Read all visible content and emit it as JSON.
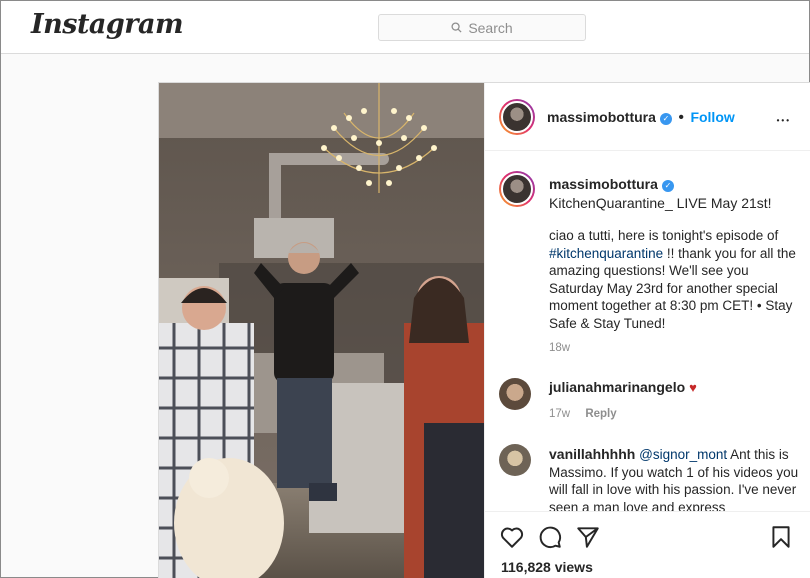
{
  "app": {
    "logo": "Instagram"
  },
  "search": {
    "placeholder": "Search"
  },
  "post": {
    "username": "massimobottura",
    "follow_separator": "•",
    "follow_label": "Follow",
    "more_label": "•••",
    "caption": {
      "username": "massimobottura",
      "title_line": "KitchenQuarantine_ LIVE May 21st!",
      "body_before_tag": "ciao a tutti, here is tonight's episode of",
      "hashtag": "#kitchenquarantine",
      "body_after_tag": "!! thank you for all the amazing questions! We'll see you Saturday May 23rd for another special moment together at 8:30 pm CET! • Stay Safe & Stay Tuned!",
      "time": "18w"
    },
    "comments": [
      {
        "username": "julianahmarinangelo",
        "text": "",
        "time": "17w",
        "reply_label": "Reply"
      },
      {
        "username": "vanillahhhhh",
        "mention": "@signor_mont",
        "text": "Ant this is Massimo. If you watch 1 of his videos you will fall in love with his passion. I've never seen a man love and express"
      }
    ],
    "views": "116,828 views"
  },
  "icons": [
    "search-icon",
    "verified-icon",
    "heart-icon",
    "comment-icon",
    "share-icon",
    "bookmark-icon",
    "more-icon"
  ],
  "colors": {
    "link": "#0095f6",
    "hashtag": "#00376b",
    "verified": "#3897f0",
    "heart": "#c62828"
  }
}
